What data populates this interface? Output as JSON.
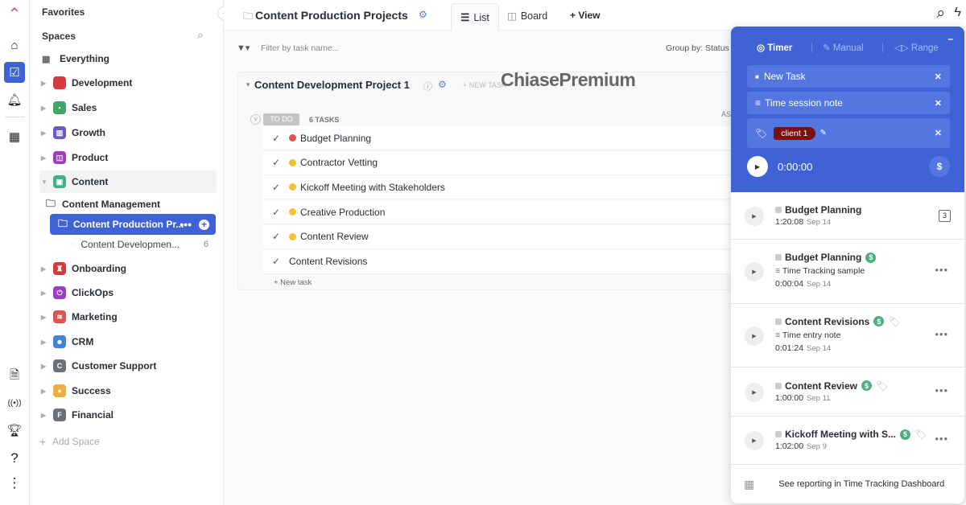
{
  "rail": {
    "icons": [
      "home-icon",
      "tasks-icon",
      "bell-icon",
      "apps-icon",
      "doc-icon",
      "broadcast-icon",
      "trophy-icon",
      "help-icon",
      "more-icon"
    ]
  },
  "sidebar": {
    "favorites": "Favorites",
    "spaces": "Spaces",
    "everything": "Everything",
    "items": [
      {
        "label": "Development",
        "color": "#d63a3a",
        "glyph": "</>"
      },
      {
        "label": "Sales",
        "color": "#3ea764",
        "glyph": "▪"
      },
      {
        "label": "Growth",
        "color": "#6a5acd",
        "glyph": "▥"
      },
      {
        "label": "Product",
        "color": "#a03cb8",
        "glyph": "◫"
      },
      {
        "label": "Content",
        "color": "#3fb28c",
        "glyph": "▣"
      },
      {
        "label": "Onboarding",
        "color": "#d63a3a",
        "glyph": "♜"
      },
      {
        "label": "ClickOps",
        "color": "#9b3cc4",
        "glyph": "⏻"
      },
      {
        "label": "Marketing",
        "color": "#e05252",
        "glyph": "≋"
      },
      {
        "label": "CRM",
        "color": "#3d85d8",
        "glyph": "☻"
      },
      {
        "label": "Customer Support",
        "color": "#6b6f7a",
        "glyph": "C"
      },
      {
        "label": "Success",
        "color": "#f0ad3c",
        "glyph": "●"
      },
      {
        "label": "Financial",
        "color": "#6b6f7a",
        "glyph": "F"
      }
    ],
    "content_management": "Content Management",
    "content_production": "Content Production Pr...",
    "content_development": "Content Developmen...",
    "content_development_count": "6",
    "add_space": "Add Space"
  },
  "header": {
    "title": "Content Production Projects",
    "tabs": [
      "List",
      "Board"
    ],
    "add_view": "+ View"
  },
  "toolbar": {
    "filter_placeholder": "Filter by task name...",
    "group_by": "Group by: Status"
  },
  "list": {
    "title": "Content Development Project 1",
    "new_task_btn": "+ NEW TASK",
    "status": "TO DO",
    "count": "6 TASKS",
    "assignee_col": "AS",
    "tasks": [
      {
        "name": "Budget Planning",
        "priority": "#d9534f"
      },
      {
        "name": "Contractor Vetting",
        "priority": "#f2c230"
      },
      {
        "name": "Kickoff Meeting with Stakeholders",
        "priority": "#f2c230"
      },
      {
        "name": "Creative Production",
        "priority": "#f2c230"
      },
      {
        "name": "Content Review",
        "priority": "#f2c230"
      },
      {
        "name": "Content Revisions",
        "priority": ""
      }
    ],
    "new_task": "+ New task"
  },
  "watermark": "ChiasePremium",
  "timer": {
    "tabs": [
      "Timer",
      "Manual",
      "Range"
    ],
    "task": "New Task",
    "note": "Time session note",
    "tag": "client 1",
    "time": "0:00:00",
    "entries": [
      {
        "title": "Budget Planning",
        "note": "",
        "time": "1:20:08",
        "date": "Sep 14",
        "badge": "3"
      },
      {
        "title": "Budget Planning",
        "note": "Time Tracking sample",
        "time": "0:00:04",
        "date": "Sep 14"
      },
      {
        "title": "Content Revisions",
        "note": "Time entry note",
        "time": "0:01:24",
        "date": "Sep 14"
      },
      {
        "title": "Content Review",
        "note": "",
        "time": "1:00:00",
        "date": "Sep 11"
      },
      {
        "title": "Kickoff Meeting with S...",
        "note": "",
        "time": "1:02:00",
        "date": "Sep 9"
      }
    ],
    "footer": "See reporting in Time Tracking Dashboard"
  }
}
